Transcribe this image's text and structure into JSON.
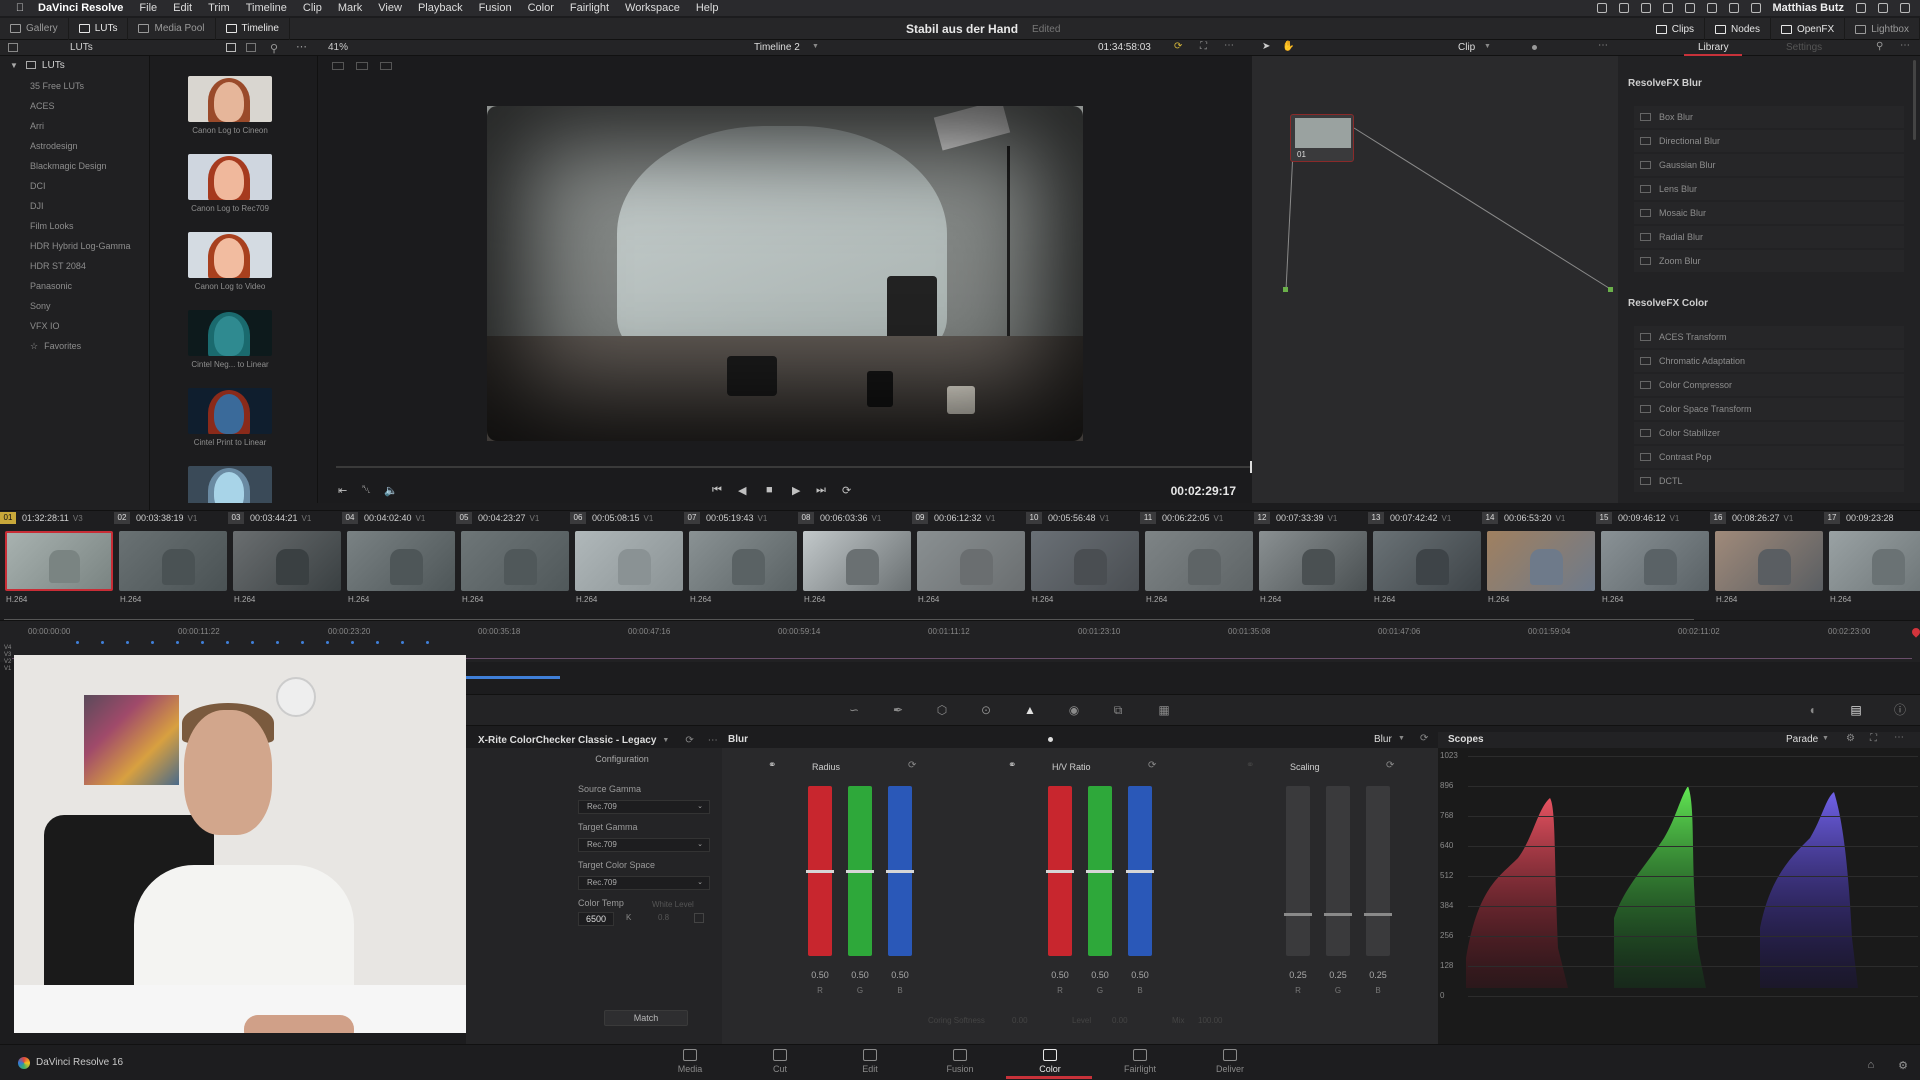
{
  "menubar": {
    "app": "DaVinci Resolve",
    "items": [
      "File",
      "Edit",
      "Trim",
      "Timeline",
      "Clip",
      "Mark",
      "View",
      "Playback",
      "Fusion",
      "Color",
      "Fairlight",
      "Workspace",
      "Help"
    ],
    "user": "Matthias Butz"
  },
  "toolbar": {
    "left": [
      "Gallery",
      "LUTs",
      "Media Pool",
      "Timeline"
    ],
    "project_title": "Stabil aus der Hand",
    "project_state": "Edited",
    "right": [
      "Clips",
      "Nodes",
      "OpenFX",
      "Lightbox"
    ]
  },
  "lut_browser": {
    "header": "LUTs",
    "root": "LUTs",
    "folders": [
      "35 Free LUTs",
      "ACES",
      "Arri",
      "Astrodesign",
      "Blackmagic Design",
      "DCI",
      "DJI",
      "Film Looks",
      "HDR Hybrid Log-Gamma",
      "HDR ST 2084",
      "Panasonic",
      "Sony",
      "VFX IO"
    ],
    "favorites": "Favorites",
    "cards": [
      "Canon Log to Cineon",
      "Canon Log to Rec709",
      "Canon Log to Video",
      "Cintel Neg... to Linear",
      "Cintel Print to Linear",
      ""
    ]
  },
  "viewer": {
    "zoom": "41%",
    "timeline_name": "Timeline 2",
    "source_timecode": "01:34:58:03",
    "current_timecode": "00:02:29:17",
    "mode": "Clip"
  },
  "nodes": {
    "node_label": "01"
  },
  "library": {
    "tabs": [
      "Library",
      "Settings"
    ],
    "sections": [
      {
        "title": "ResolveFX Blur",
        "items": [
          "Box Blur",
          "Directional Blur",
          "Gaussian Blur",
          "Lens Blur",
          "Mosaic Blur",
          "Radial Blur",
          "Zoom Blur"
        ]
      },
      {
        "title": "ResolveFX Color",
        "items": [
          "ACES Transform",
          "Chromatic Adaptation",
          "Color Compressor",
          "Color Space Transform",
          "Color Stabilizer",
          "Contrast Pop",
          "DCTL"
        ]
      }
    ]
  },
  "clips": [
    {
      "num": "01",
      "tc": "01:32:28:11",
      "trk": "V3",
      "codec": "H.264"
    },
    {
      "num": "02",
      "tc": "00:03:38:19",
      "trk": "V1",
      "codec": "H.264"
    },
    {
      "num": "03",
      "tc": "00:03:44:21",
      "trk": "V1",
      "codec": "H.264"
    },
    {
      "num": "04",
      "tc": "00:04:02:40",
      "trk": "V1",
      "codec": "H.264"
    },
    {
      "num": "05",
      "tc": "00:04:23:27",
      "trk": "V1",
      "codec": "H.264"
    },
    {
      "num": "06",
      "tc": "00:05:08:15",
      "trk": "V1",
      "codec": "H.264"
    },
    {
      "num": "07",
      "tc": "00:05:19:43",
      "trk": "V1",
      "codec": "H.264"
    },
    {
      "num": "08",
      "tc": "00:06:03:36",
      "trk": "V1",
      "codec": "H.264"
    },
    {
      "num": "09",
      "tc": "00:06:12:32",
      "trk": "V1",
      "codec": "H.264"
    },
    {
      "num": "10",
      "tc": "00:05:56:48",
      "trk": "V1",
      "codec": "H.264"
    },
    {
      "num": "11",
      "tc": "00:06:22:05",
      "trk": "V1",
      "codec": "H.264"
    },
    {
      "num": "12",
      "tc": "00:07:33:39",
      "trk": "V1",
      "codec": "H.264"
    },
    {
      "num": "13",
      "tc": "00:07:42:42",
      "trk": "V1",
      "codec": "H.264"
    },
    {
      "num": "14",
      "tc": "00:06:53:20",
      "trk": "V1",
      "codec": "H.264"
    },
    {
      "num": "15",
      "tc": "00:09:46:12",
      "trk": "V1",
      "codec": "H.264"
    },
    {
      "num": "16",
      "tc": "00:08:26:27",
      "trk": "V1",
      "codec": "H.264"
    },
    {
      "num": "17",
      "tc": "00:09:23:28",
      "trk": "",
      "codec": "H.264"
    }
  ],
  "ruler": {
    "ticks": [
      "00:00:00:00",
      "00:00:11:22",
      "00:00:23:20",
      "00:00:35:18",
      "00:00:47:16",
      "00:00:59:14",
      "00:01:11:12",
      "00:01:23:10",
      "00:01:35:08",
      "00:01:47:06",
      "00:01:59:04",
      "00:02:11:02",
      "00:02:23:00"
    ],
    "lanes": [
      "V4",
      "V3",
      "V2",
      "V1"
    ]
  },
  "color_checker": {
    "title": "X-Rite ColorChecker Classic - Legacy",
    "section": "Configuration",
    "source_gamma_label": "Source Gamma",
    "source_gamma": "Rec.709",
    "target_gamma_label": "Target Gamma",
    "target_gamma": "Rec.709",
    "target_space_label": "Target Color Space",
    "target_space": "Rec.709",
    "color_temp_label": "Color Temp",
    "color_temp": "6500",
    "unit": "K",
    "white_level_label": "White Level",
    "white_level": "0.8",
    "match": "Match"
  },
  "blur": {
    "title": "Blur",
    "mode": "Blur",
    "groups": [
      {
        "name": "Radius",
        "values": [
          "0.50",
          "0.50",
          "0.50"
        ],
        "levels": [
          0.5,
          0.5,
          0.5
        ]
      },
      {
        "name": "H/V Ratio",
        "values": [
          "0.50",
          "0.50",
          "0.50"
        ],
        "levels": [
          0.5,
          0.5,
          0.5
        ]
      },
      {
        "name": "Scaling",
        "values": [
          "0.25",
          "0.25",
          "0.25"
        ],
        "levels": [
          0.25,
          0.25,
          0.25
        ]
      }
    ],
    "channels": [
      "R",
      "G",
      "B"
    ],
    "footer": {
      "coring_label": "Coring Softness",
      "coring": "0.00",
      "level_label": "Level",
      "level": "0.00",
      "mix_label": "Mix",
      "mix": "100.00"
    }
  },
  "scopes": {
    "title": "Scopes",
    "mode": "Parade",
    "scale": [
      "1023",
      "896",
      "768",
      "640",
      "512",
      "384",
      "256",
      "128",
      "0"
    ]
  },
  "bottom": {
    "brand": "DaVinci Resolve 16",
    "pages": [
      "Media",
      "Cut",
      "Edit",
      "Fusion",
      "Color",
      "Fairlight",
      "Deliver"
    ],
    "active": "Color"
  }
}
